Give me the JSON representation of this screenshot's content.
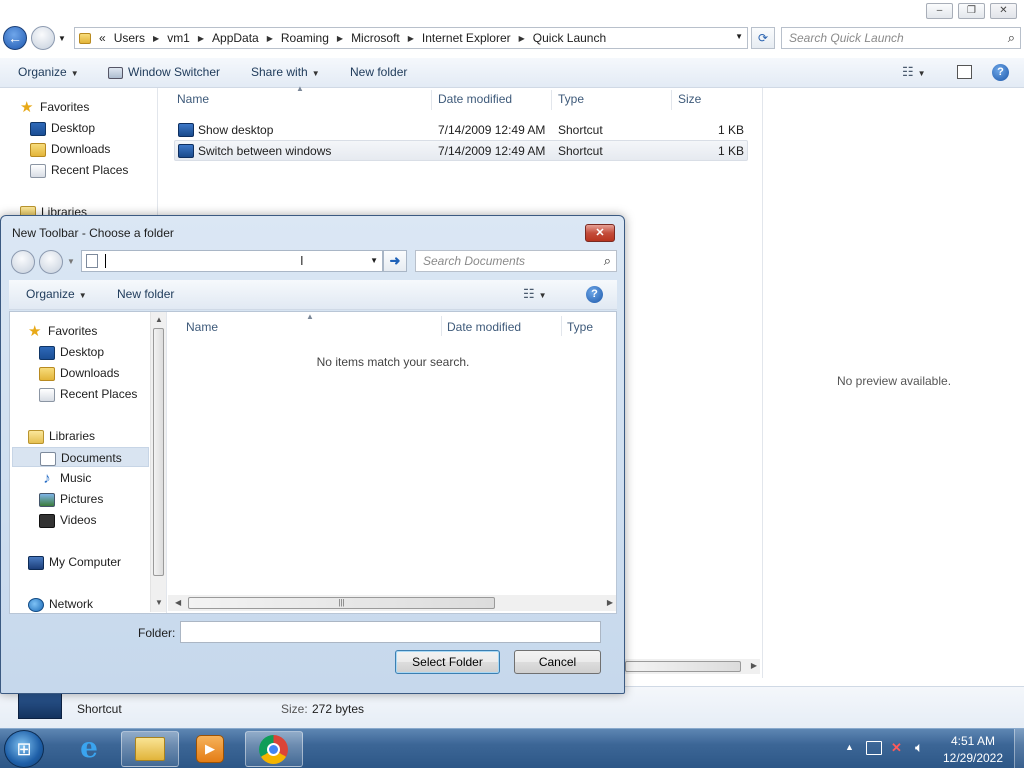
{
  "explorer": {
    "address_prefix": "«",
    "breadcrumbs": [
      "Users",
      "vm1",
      "AppData",
      "Roaming",
      "Microsoft",
      "Internet Explorer",
      "Quick Launch"
    ],
    "search_placeholder": "Search Quick Launch",
    "toolbar": {
      "organize": "Organize",
      "window_switcher": "Window Switcher",
      "share_with": "Share with",
      "new_folder": "New folder"
    },
    "nav": {
      "favorites": "Favorites",
      "desktop": "Desktop",
      "downloads": "Downloads",
      "recent_places": "Recent Places",
      "libraries": "Libraries"
    },
    "columns": {
      "name": "Name",
      "date_modified": "Date modified",
      "type": "Type",
      "size": "Size"
    },
    "files": [
      {
        "name": "Show desktop",
        "date": "7/14/2009 12:49 AM",
        "type": "Shortcut",
        "size": "1 KB"
      },
      {
        "name": "Switch between windows",
        "date": "7/14/2009 12:49 AM",
        "type": "Shortcut",
        "size": "1 KB"
      }
    ],
    "preview_text": "No preview available.",
    "details": {
      "type": "Shortcut",
      "size_label": "Size:",
      "size_value": "272 bytes"
    }
  },
  "dialog": {
    "title": "New Toolbar - Choose a folder",
    "search_placeholder": "Search Documents",
    "toolbar": {
      "organize": "Organize",
      "new_folder": "New folder"
    },
    "nav": {
      "favorites": "Favorites",
      "desktop": "Desktop",
      "downloads": "Downloads",
      "recent_places": "Recent Places",
      "libraries": "Libraries",
      "documents": "Documents",
      "music": "Music",
      "pictures": "Pictures",
      "videos": "Videos",
      "my_computer": "My Computer",
      "network": "Network"
    },
    "columns": {
      "name": "Name",
      "date_modified": "Date modified",
      "type": "Type"
    },
    "empty_message": "No items match your search.",
    "folder_label": "Folder:",
    "folder_value": "",
    "select_button": "Select Folder",
    "cancel_button": "Cancel"
  },
  "taskbar": {
    "clock_time": "4:51 AM",
    "clock_date": "12/29/2022"
  },
  "colors": {
    "accent": "#3c6696",
    "selection": "#e6eaf0"
  }
}
